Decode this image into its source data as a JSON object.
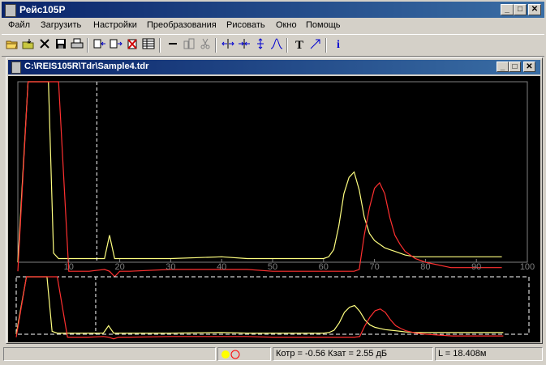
{
  "app": {
    "title": "Рейс105Р"
  },
  "window_controls": {
    "minimize": "_",
    "maximize": "□",
    "close": "✕"
  },
  "menu": [
    "Файл",
    "Загрузить",
    "Настройки",
    "Преобразования",
    "Рисовать",
    "Окно",
    "Помощь"
  ],
  "toolbar": {
    "icons": [
      "open-folder-icon",
      "load-icon",
      "delete-icon",
      "save-icon",
      "print-icon",
      "import-icon",
      "export-icon",
      "clear-icon",
      "table-icon",
      "minus-icon",
      "building-icon",
      "cut-icon",
      "marker-left-icon",
      "marker-right-icon",
      "peak-icon",
      "curve-icon",
      "text-icon",
      "arrow-icon",
      "info-icon"
    ],
    "text_glyph": "T",
    "info_glyph": "i"
  },
  "document": {
    "title": "C:\\REIS105R\\Tdr\\Sample4.tdr"
  },
  "chart_data": {
    "type": "line",
    "x": [
      0,
      2,
      3,
      4,
      5,
      6,
      7,
      8,
      10,
      14,
      17,
      18,
      19,
      20,
      21,
      22,
      30,
      40,
      45,
      50,
      60,
      61,
      62,
      63,
      64,
      65,
      66,
      67,
      68,
      69,
      70,
      71,
      72,
      73,
      74,
      75,
      76,
      78,
      80,
      85,
      90,
      95
    ],
    "x_ticks": [
      "10",
      "20",
      "30",
      "40",
      "50",
      "60",
      "70",
      "80",
      "90",
      "100"
    ],
    "xlim": [
      0,
      100
    ],
    "ylim": [
      0,
      100
    ],
    "cursor_x": 15.5,
    "series": [
      {
        "color": "#ffff80",
        "values": [
          0,
          100,
          100,
          100,
          100,
          100,
          5,
          2,
          2,
          2,
          2,
          15,
          2,
          2,
          2,
          2,
          2,
          3,
          2,
          2,
          2,
          3,
          7,
          20,
          38,
          47,
          50,
          40,
          25,
          16,
          12,
          10,
          8,
          7,
          6,
          5,
          4,
          3,
          3,
          3,
          3,
          3
        ]
      },
      {
        "color": "#ff3030",
        "values": [
          -5,
          100,
          100,
          100,
          100,
          100,
          100,
          100,
          -5,
          -5,
          -4,
          -5,
          -8,
          -5,
          -5,
          -5,
          -4,
          -4,
          -4,
          -5,
          -5,
          -5,
          -5,
          -5,
          -5,
          -5,
          -5,
          -4,
          15,
          30,
          41,
          44,
          38,
          25,
          15,
          10,
          6,
          2,
          0,
          -3,
          -3,
          -3
        ]
      }
    ]
  },
  "status": {
    "coefficients": "Котр = -0.56  Кзат = 2.55 дБ",
    "length": "L = 18.408м"
  },
  "colors": {
    "title_bar": "#0a246a",
    "plot_bg": "#000000",
    "grid": "#808080",
    "trace_1": "#ffff80",
    "trace_2": "#ff3030",
    "indicator_yellow": "#ffff00",
    "indicator_red": "#ff0000"
  }
}
